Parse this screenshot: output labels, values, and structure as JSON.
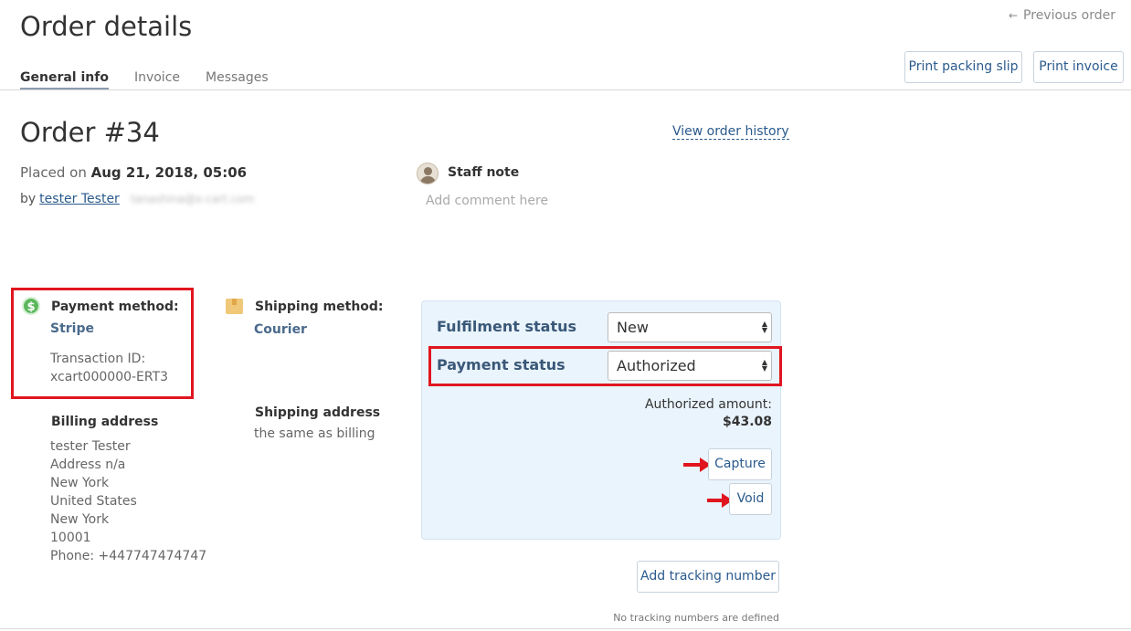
{
  "header": {
    "title": "Order details",
    "previous_order": "Previous order",
    "previous_arrow": "←",
    "tabs": [
      {
        "label": "General info",
        "active": true
      },
      {
        "label": "Invoice",
        "active": false
      },
      {
        "label": "Messages",
        "active": false
      }
    ],
    "print_packing_slip": "Print packing slip",
    "print_invoice": "Print invoice"
  },
  "order": {
    "number": "Order #34",
    "view_history": "View order history",
    "placed_prefix": "Placed on",
    "placed_date": "Aug 21, 2018, 05:06",
    "by_prefix": "by",
    "customer_name": "tester Tester",
    "customer_email": "tanashina@x-cart.com"
  },
  "staff_note": {
    "label": "Staff note",
    "placeholder": "Add comment here"
  },
  "payment": {
    "icon": "$",
    "label": "Payment method:",
    "method": "Stripe",
    "transaction_label": "Transaction ID:",
    "transaction_id": "xcart000000-ERT3"
  },
  "billing": {
    "label": "Billing address",
    "lines": [
      "tester Tester",
      "Address n/a",
      "New York",
      "United States",
      "New York",
      "10001",
      "Phone: +447747474747"
    ]
  },
  "shipping": {
    "label": "Shipping method:",
    "method": "Courier",
    "address_label": "Shipping address",
    "address_value": "the same as billing"
  },
  "status": {
    "fulfilment_label": "Fulfilment status",
    "fulfilment_value": "New",
    "payment_label": "Payment status",
    "payment_value": "Authorized",
    "authorized_amount_label": "Authorized amount:",
    "authorized_amount": "$43.08",
    "capture_label": "Capture",
    "void_label": "Void"
  },
  "tracking": {
    "add_label": "Add tracking number",
    "empty_text": "No tracking numbers are defined"
  },
  "colors": {
    "highlight_red": "#e0151f",
    "link_blue": "#2a5a8c",
    "panel_bg": "#eaf4fc",
    "dollar_green": "#5cb85c"
  }
}
